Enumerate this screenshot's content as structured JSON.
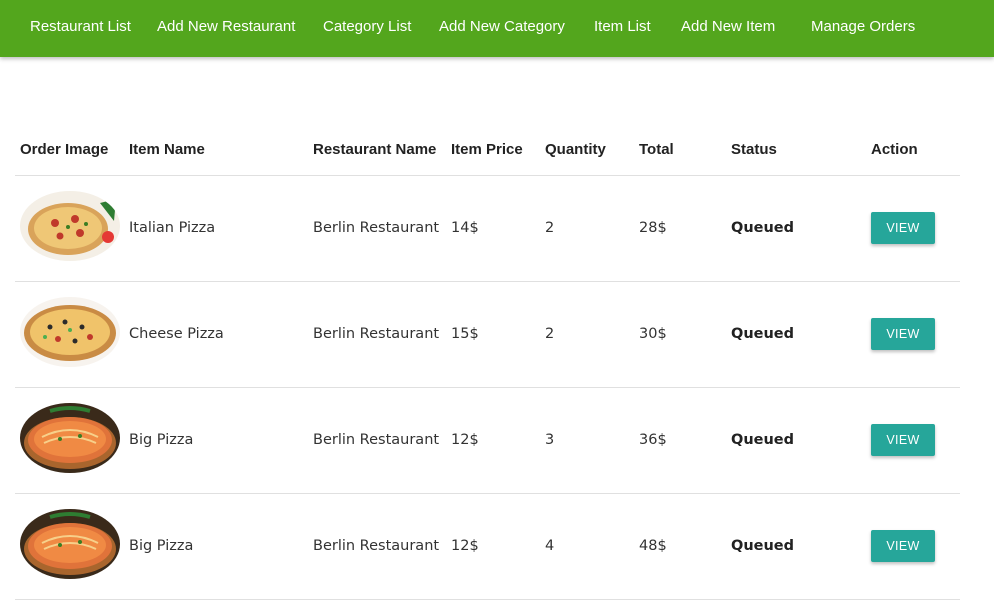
{
  "nav": {
    "items": [
      "Restaurant List",
      "Add New Restaurant",
      "Category List",
      "Add New Category",
      "Item List",
      "Add New Item",
      "Manage Orders"
    ]
  },
  "table": {
    "headers": [
      "Order Image",
      "Item Name",
      "Restaurant Name",
      "Item Price",
      "Quantity",
      "Total",
      "Status",
      "Action"
    ],
    "rows": [
      {
        "image": "pizza-image",
        "item_name": "Italian Pizza",
        "restaurant": "Berlin Restaurant",
        "price": "14$",
        "quantity": "2",
        "total": "28$",
        "status": "Queued",
        "action": "VIEW"
      },
      {
        "image": "pizza-image",
        "item_name": "Cheese Pizza",
        "restaurant": "Berlin Restaurant",
        "price": "15$",
        "quantity": "2",
        "total": "30$",
        "status": "Queued",
        "action": "VIEW"
      },
      {
        "image": "pizza-image",
        "item_name": "Big Pizza",
        "restaurant": "Berlin Restaurant",
        "price": "12$",
        "quantity": "3",
        "total": "36$",
        "status": "Queued",
        "action": "VIEW"
      },
      {
        "image": "pizza-image",
        "item_name": "Big Pizza",
        "restaurant": "Berlin Restaurant",
        "price": "12$",
        "quantity": "4",
        "total": "48$",
        "status": "Queued",
        "action": "VIEW"
      }
    ]
  },
  "colors": {
    "navbar": "#53a61d",
    "button": "#26a69a"
  }
}
